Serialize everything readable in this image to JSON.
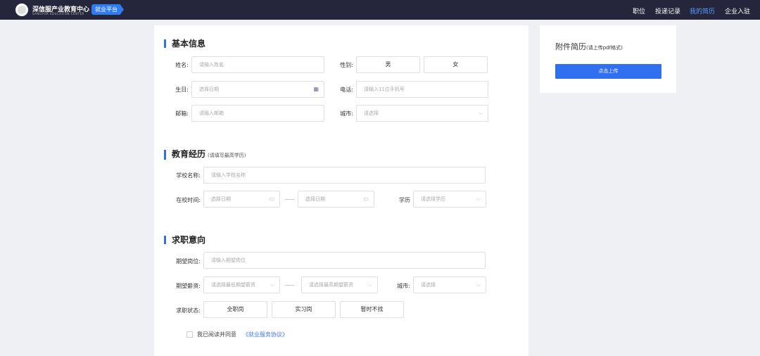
{
  "nav": {
    "brand": "深信服产业教育中心",
    "brand_sub": "SANGFOR EDUCATION CENTER",
    "badge": "就业平台",
    "links": [
      "职位",
      "投递记录",
      "我的简历",
      "企业入驻"
    ],
    "active": "我的简历"
  },
  "basic": {
    "title": "基本信息",
    "name_label": "姓名:",
    "name_ph": "请输入姓名",
    "gender_label": "性别:",
    "male": "男",
    "female": "女",
    "birth_label": "生日:",
    "birth_ph": "选择日期",
    "phone_label": "电话:",
    "phone_ph": "请输入11位手机号",
    "email_label": "邮箱:",
    "email_ph": "请输入邮箱",
    "city_label": "城市:",
    "city_ph": "请选择"
  },
  "edu": {
    "title": "教育经历",
    "note": "(请填写最高学历)",
    "school_label": "学校名称:",
    "school_ph": "请输入学校名称",
    "time_label": "在校时间:",
    "start_ph": "选择日期",
    "end_ph": "选择日期",
    "degree_label": "学历",
    "degree_ph": "请选择学历"
  },
  "job": {
    "title": "求职意向",
    "pos_label": "期望岗位:",
    "pos_ph": "请输入期望岗位",
    "salary_label": "期望薪资:",
    "min_ph": "请选择最低期望薪资",
    "max_ph": "请选择最高期望薪资",
    "city_label": "城市:",
    "city_ph": "请选择",
    "status_label": "求职状态:",
    "status": [
      "全职岗",
      "实习岗",
      "暂时不找"
    ],
    "agree": "我已阅读并同意",
    "agreement": "《就业服务协议》"
  },
  "attach": {
    "title": "附件简历",
    "note": "(请上传pdf格式)",
    "upload": "点击上传"
  },
  "colors": {
    "accent": "#2f6ff0",
    "nav_bg": "#25253b"
  }
}
